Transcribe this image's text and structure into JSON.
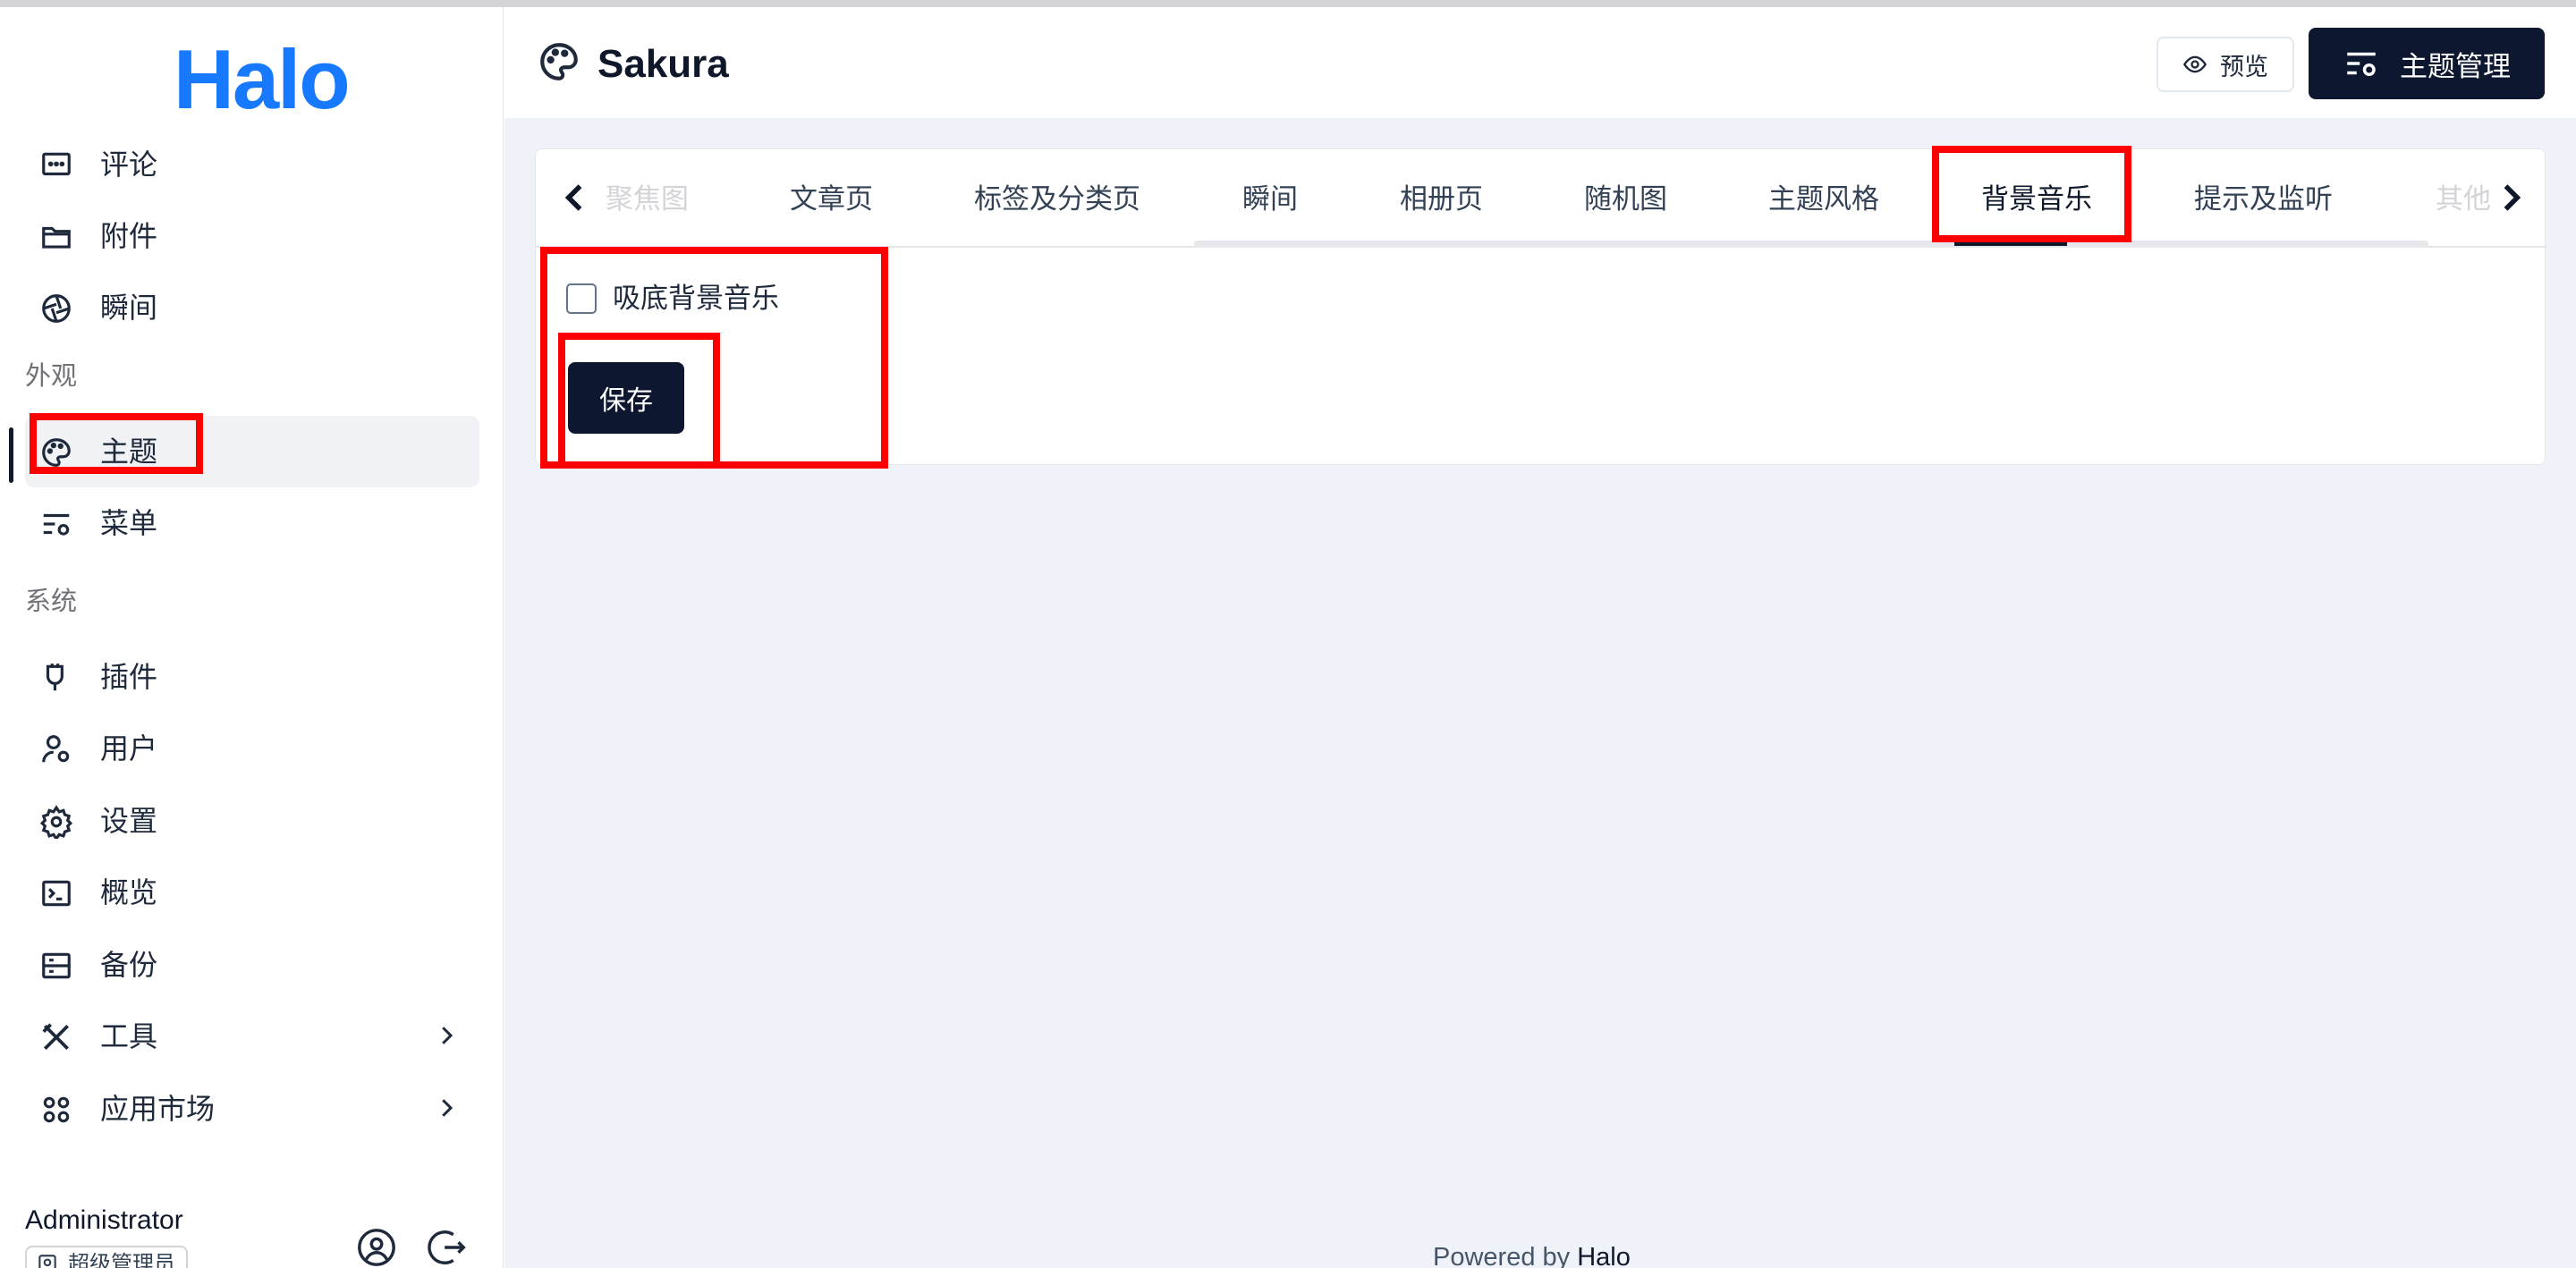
{
  "brand": {
    "logo_text": "Halo",
    "accent": "#1679ff"
  },
  "sidebar": {
    "items_top": [
      {
        "label": "评论",
        "icon": "comment-icon"
      },
      {
        "label": "附件",
        "icon": "folder-icon"
      },
      {
        "label": "瞬间",
        "icon": "aperture-icon"
      }
    ],
    "group_appearance": "外观",
    "items_appearance": [
      {
        "label": "主题",
        "icon": "palette-icon",
        "active": true
      },
      {
        "label": "菜单",
        "icon": "menu-settings-icon"
      }
    ],
    "group_system": "系统",
    "items_system": [
      {
        "label": "插件",
        "icon": "plug-icon"
      },
      {
        "label": "用户",
        "icon": "user-gear-icon"
      },
      {
        "label": "设置",
        "icon": "gear-icon"
      },
      {
        "label": "概览",
        "icon": "terminal-icon"
      },
      {
        "label": "备份",
        "icon": "backup-icon"
      },
      {
        "label": "工具",
        "icon": "tools-icon",
        "expandable": true
      },
      {
        "label": "应用市场",
        "icon": "apps-icon",
        "expandable": true
      }
    ],
    "user": {
      "name": "Administrator",
      "role": "超级管理员"
    }
  },
  "header": {
    "title": "Sakura",
    "preview_label": "预览",
    "manage_label": "主题管理"
  },
  "tabs": {
    "items": [
      "聚焦图",
      "文章页",
      "标签及分类页",
      "瞬间",
      "相册页",
      "随机图",
      "主题风格",
      "背景音乐",
      "提示及监听",
      "其他"
    ],
    "active": "背景音乐"
  },
  "form": {
    "checkbox_label": "吸底背景音乐",
    "checkbox_checked": false,
    "save_label": "保存"
  },
  "footer": {
    "powered_prefix": "Powered by",
    "powered_brand": "Halo"
  },
  "colors": {
    "primary_dark": "#0d1730",
    "annotation_red": "#ff0000",
    "page_bg": "#eff3f9"
  }
}
